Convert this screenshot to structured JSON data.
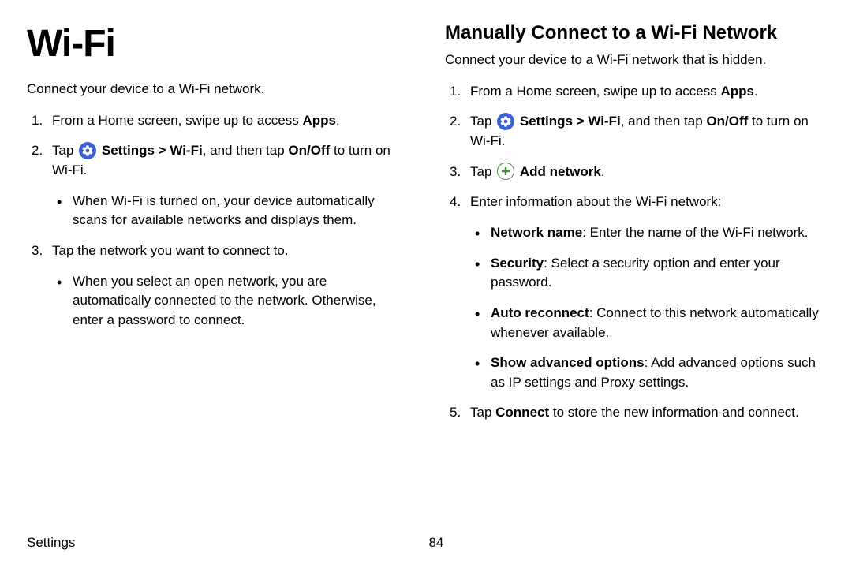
{
  "left": {
    "title": "Wi-Fi",
    "intro": "Connect your device to a Wi-Fi network.",
    "step1_pre": "From a Home screen, swipe up to access ",
    "step1_bold": "Apps",
    "step1_post": ".",
    "step2_pre": "Tap ",
    "step2_bold1": "Settings",
    "step2_sep": " > ",
    "step2_bold2": "Wi-Fi",
    "step2_mid": ", and then tap ",
    "step2_bold3": "On/Off",
    "step2_post": " to turn on Wi-Fi.",
    "step2_sub": "When Wi-Fi is turned on, your device automatically scans for available networks and displays them.",
    "step3": "Tap the network you want to connect to.",
    "step3_sub": "When you select an open network, you are automatically connected to the network. Otherwise, enter a password to connect."
  },
  "right": {
    "title": "Manually Connect to a Wi-Fi Network",
    "intro": "Connect your device to a Wi-Fi network that is hidden.",
    "step1_pre": "From a Home screen, swipe up to access ",
    "step1_bold": "Apps",
    "step1_post": ".",
    "step2_pre": "Tap ",
    "step2_bold1": "Settings",
    "step2_sep": " > ",
    "step2_bold2": "Wi-Fi",
    "step2_mid": ", and then tap ",
    "step2_bold3": "On/Off",
    "step2_post": " to turn on Wi-Fi.",
    "step3_pre": "Tap ",
    "step3_bold": "Add network",
    "step3_post": ".",
    "step4": "Enter information about the Wi-Fi network:",
    "step4_b1_bold": "Network name",
    "step4_b1_text": ": Enter the name of the Wi-Fi network.",
    "step4_b2_bold": "Security",
    "step4_b2_text": ": Select a security option and enter your password.",
    "step4_b3_bold": "Auto reconnect",
    "step4_b3_text": ": Connect to this network automatically whenever available.",
    "step4_b4_bold": "Show advanced options",
    "step4_b4_text": ": Add advanced options such as IP settings and Proxy settings.",
    "step5_pre": "Tap ",
    "step5_bold": "Connect",
    "step5_post": " to store the new information and connect."
  },
  "footer": {
    "label": "Settings",
    "page": "84"
  }
}
